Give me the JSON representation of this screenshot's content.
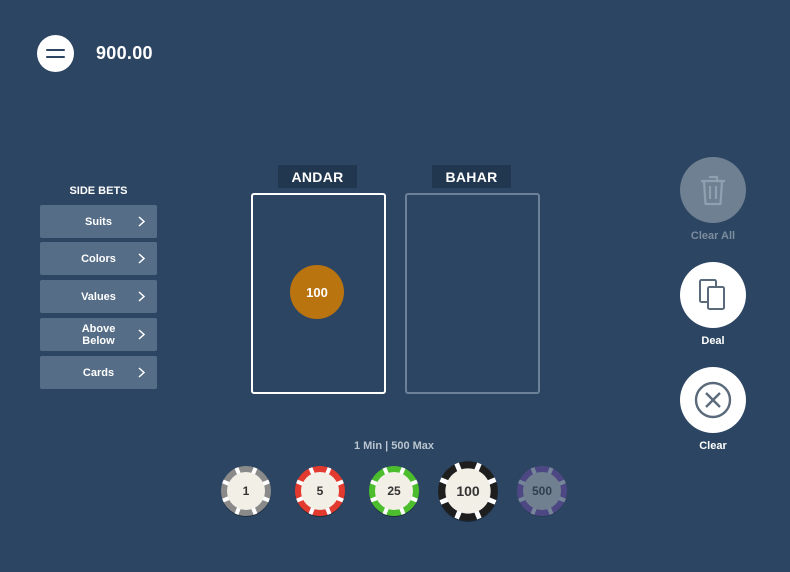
{
  "header": {
    "balance": "900.00",
    "menu_icon": "hamburger-menu-icon"
  },
  "side_bets": {
    "title": "SIDE BETS",
    "items": [
      {
        "label": "Suits"
      },
      {
        "label": "Colors"
      },
      {
        "label": "Values"
      },
      {
        "label": "Above\nBelow"
      },
      {
        "label": "Cards"
      }
    ]
  },
  "zones": {
    "andar": {
      "label": "ANDAR",
      "placed_chip": "100",
      "chip_color": "#b9740f"
    },
    "bahar": {
      "label": "BAHAR"
    }
  },
  "actions": {
    "clear_all": {
      "label": "Clear All",
      "icon": "trash-icon",
      "enabled": false
    },
    "deal": {
      "label": "Deal",
      "icon": "copy-cards-icon"
    },
    "clear": {
      "label": "Clear",
      "icon": "close-circle-icon"
    }
  },
  "limits": "1 Min | 500 Max",
  "chips": [
    {
      "value": "1",
      "color": "#8a8a8a"
    },
    {
      "value": "5",
      "color": "#e23a2e"
    },
    {
      "value": "25",
      "color": "#4cbe2e"
    },
    {
      "value": "100",
      "color": "#1e1e1e",
      "selected": true
    },
    {
      "value": "500",
      "color": "#8a4ec2",
      "disabled": true
    }
  ],
  "colors": {
    "background": "#2c4562",
    "side_button": "#556d86",
    "zone_label_bg": "#213750"
  }
}
